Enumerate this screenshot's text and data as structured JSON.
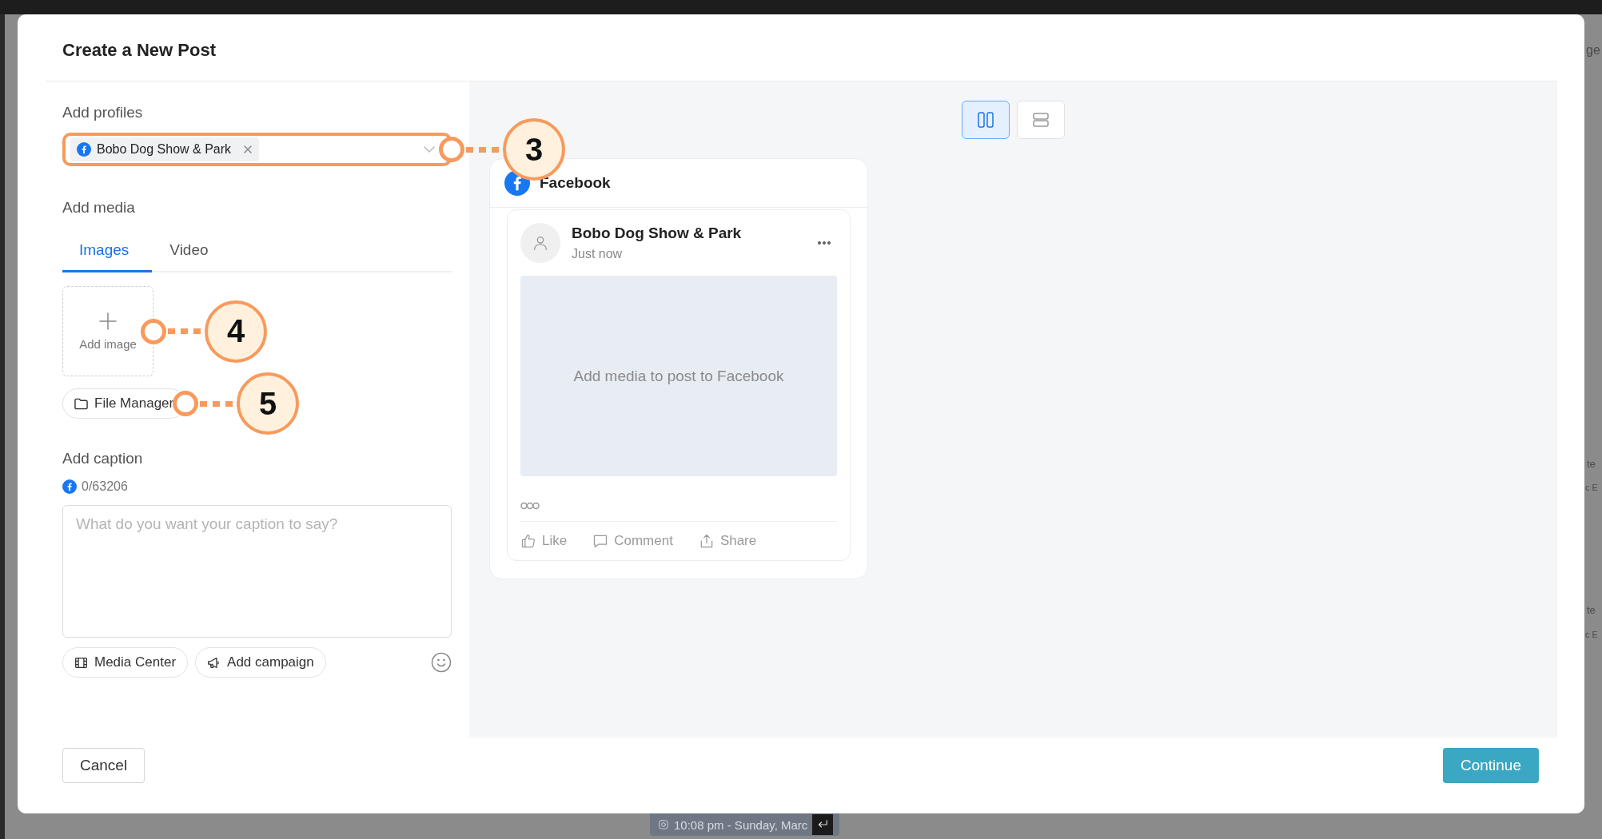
{
  "dialog": {
    "title": "Create a New Post"
  },
  "profiles": {
    "label": "Add profiles",
    "chips": [
      {
        "name": "Bobo Dog Show & Park"
      }
    ],
    "callout": "3"
  },
  "media": {
    "label": "Add media",
    "tabs": [
      {
        "label": "Images",
        "selected": true
      },
      {
        "label": "Video",
        "selected": false
      }
    ],
    "add_image": "Add image",
    "add_image_callout": "4",
    "file_manager": "File Manager",
    "file_manager_callout": "5"
  },
  "caption": {
    "label": "Add caption",
    "counter": "0/63206",
    "placeholder": "What do you want your caption to say?",
    "buttons": [
      {
        "kind": "media",
        "label": "Media Center"
      },
      {
        "kind": "campaign",
        "label": "Add campaign"
      }
    ]
  },
  "preview": {
    "layouts": [
      {
        "kind": "columns",
        "selected": true
      },
      {
        "kind": "rows",
        "selected": false
      }
    ],
    "network": "Facebook",
    "page_name": "Bobo Dog Show & Park",
    "time": "Just now",
    "media_placeholder": "Add media to post to Facebook",
    "actions": [
      {
        "kind": "like",
        "label": "Like"
      },
      {
        "kind": "comment",
        "label": "Comment"
      },
      {
        "kind": "share",
        "label": "Share"
      }
    ]
  },
  "footer": {
    "cancel": "Cancel",
    "continue": "Continue"
  },
  "background": {
    "top_right_text": "ge",
    "right_texts": [
      "te",
      "c E",
      "te",
      "c E"
    ],
    "bottom_chip": "10:08 pm - Sunday, Marc"
  }
}
